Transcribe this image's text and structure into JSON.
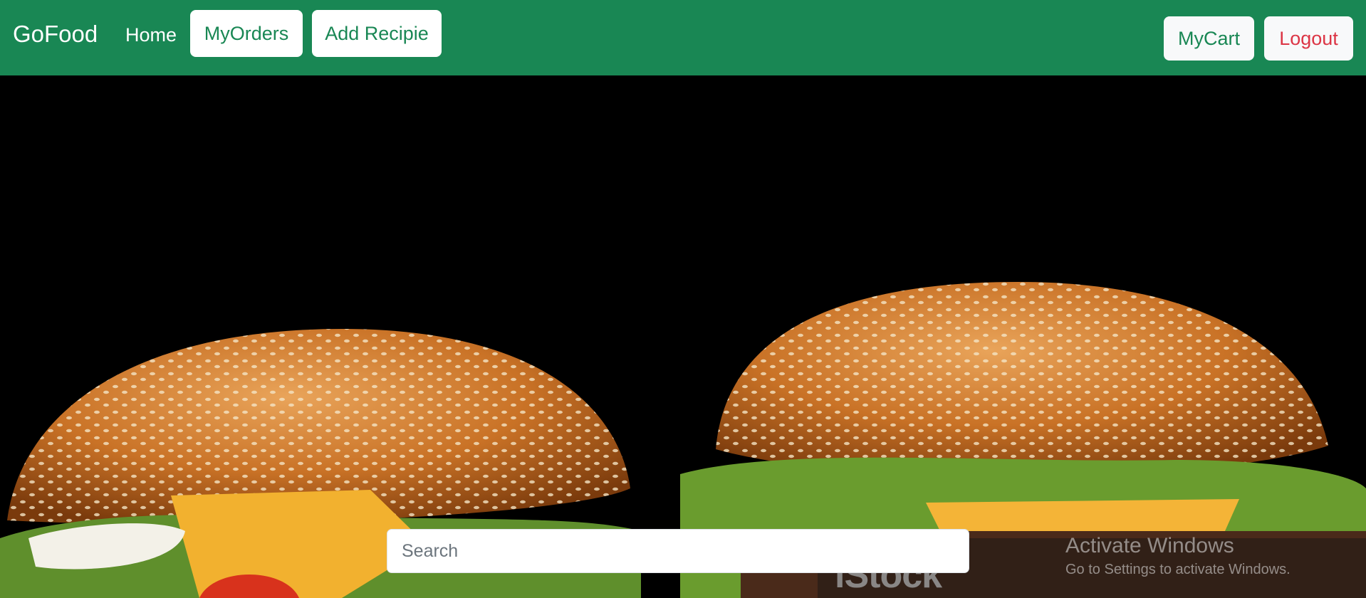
{
  "navbar": {
    "brand": "GoFood",
    "home": "Home",
    "my_orders": "MyOrders",
    "add_recipe": "Add Recipie",
    "my_cart": "MyCart",
    "logout": "Logout"
  },
  "hero": {
    "image": "burger-photo",
    "watermark": "iStock"
  },
  "search": {
    "placeholder": "Search"
  },
  "os_overlay": {
    "title": "Activate Windows",
    "subtitle": "Go to Settings to activate Windows."
  },
  "colors": {
    "navbar": "#198754",
    "logout": "#dc3545"
  }
}
